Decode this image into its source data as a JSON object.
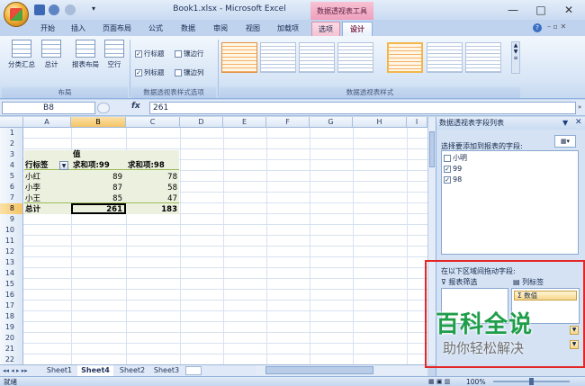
{
  "titlebar": {
    "title": "Book1.xlsx - Microsoft Excel",
    "context_title": "数据透视表工具",
    "qat_extra": "▾"
  },
  "tabs": [
    "开始",
    "插入",
    "页面布局",
    "公式",
    "数据",
    "审阅",
    "视图",
    "加载项",
    "选项",
    "设计"
  ],
  "ribbon": {
    "layout_buttons": [
      "分类汇总",
      "总计",
      "报表布局",
      "空行"
    ],
    "options": {
      "row_headers": "行标题",
      "col_headers": "列标题",
      "banded_rows": "镶边行",
      "banded_cols": "镶边列"
    },
    "group_labels": {
      "layout": "布局",
      "style_options": "数据透视表样式选项",
      "styles": "数据透视表样式"
    }
  },
  "formula_bar": {
    "name_box": "B8",
    "fx": "fx",
    "value": "261"
  },
  "grid": {
    "columns": [
      "A",
      "B",
      "C",
      "D",
      "E",
      "F",
      "G",
      "H",
      "I"
    ],
    "rows": [
      "1",
      "2",
      "3",
      "4",
      "5",
      "6",
      "7",
      "8",
      "9",
      "10",
      "11",
      "12",
      "13",
      "14",
      "15",
      "16",
      "17",
      "18",
      "19",
      "20",
      "21",
      "22"
    ],
    "b3": "值",
    "a4": "行标签",
    "b4": "求和项:99",
    "c4": "求和项:98",
    "data": [
      {
        "name": "小红",
        "b": "89",
        "c": "78"
      },
      {
        "name": "小李",
        "b": "87",
        "c": "58"
      },
      {
        "name": "小王",
        "b": "85",
        "c": "47"
      }
    ],
    "total": {
      "name": "总计",
      "b": "261",
      "c": "183"
    }
  },
  "sheets": [
    "Sheet1",
    "Sheet4",
    "Sheet2",
    "Sheet3"
  ],
  "pane": {
    "title": "数据透视表字段列表",
    "choose_fields": "选择要添加到报表的字段:",
    "fields": [
      "小明",
      "99",
      "98"
    ],
    "drag_areas": "在以下区域间拖动字段:",
    "report_filter": "报表筛选",
    "column_labels": "列标签",
    "column_item": "Σ 数值"
  },
  "watermark": {
    "line1": "百科全说",
    "line2": "助你轻松解决"
  },
  "status": {
    "left": "就绪",
    "zoom": "100%"
  }
}
